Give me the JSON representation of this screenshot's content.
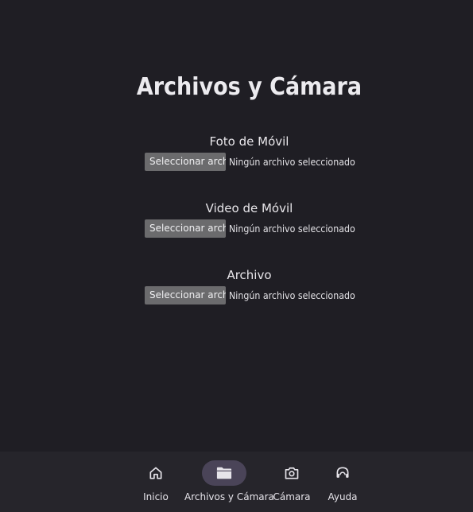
{
  "page": {
    "title": "Archivos y Cámara"
  },
  "fields": [
    {
      "label": "Foto de Móvil",
      "button_label": "Seleccionar archivo",
      "status": "Ningún archivo seleccionado"
    },
    {
      "label": "Video de Móvil",
      "button_label": "Seleccionar archivo",
      "status": "Ningún archivo seleccionado"
    },
    {
      "label": "Archivo",
      "button_label": "Seleccionar archivo",
      "status": "Ningún archivo seleccionado"
    }
  ],
  "nav": {
    "items": [
      {
        "label": "Inicio",
        "icon": "home-icon",
        "active": false
      },
      {
        "label": "Archivos y Cámara",
        "icon": "folder-icon",
        "active": true
      },
      {
        "label": "Cámara",
        "icon": "camera-icon",
        "active": false
      },
      {
        "label": "Ayuda",
        "icon": "headset-icon",
        "active": false
      }
    ]
  },
  "colors": {
    "background": "#1f1e24",
    "nav_background": "#26252b",
    "active_indicator": "#4a4458",
    "button_background": "#6b6b6d",
    "text": "#e8e6ea"
  }
}
